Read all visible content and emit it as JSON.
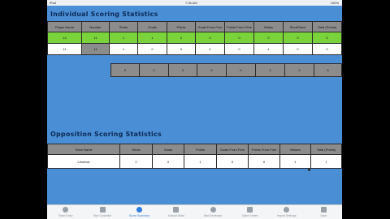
{
  "status": {
    "left": "iPad",
    "time": "7:36 AM",
    "right": "100%"
  },
  "individual": {
    "title": "Individual Scoring Statistics",
    "headers": [
      "Player Name",
      "Number",
      "Shots",
      "Goals",
      "Points",
      "Goals From Free",
      "Points From Free",
      "Wides",
      "Short/Save",
      "Total (Points)"
    ],
    "rows": [
      [
        "14",
        "11",
        "1",
        "1",
        "2",
        "0",
        "0",
        "0",
        "0",
        "5"
      ],
      [
        "11",
        "11",
        "1",
        "0",
        "0",
        "0",
        "0",
        "1",
        "0",
        "0"
      ]
    ],
    "totals": [
      "2",
      "1",
      "2",
      "0",
      "0",
      "1",
      "0",
      "5"
    ]
  },
  "opposition": {
    "title": "Opposition Scoring Statistics",
    "headers": [
      "Team Name",
      "Shots",
      "Goals",
      "Points",
      "Goals From Free",
      "Points From Free",
      "Misses",
      "Total (Points)"
    ],
    "rows": [
      [
        "Limerick",
        "2",
        "0",
        "1",
        "0",
        "0",
        "1",
        "1"
      ]
    ]
  },
  "tabs": [
    {
      "label": "Team Entry",
      "icon": "team-icon"
    },
    {
      "label": "Stat Controller",
      "icon": "controller-icon"
    },
    {
      "label": "Score Summary",
      "icon": "score-icon"
    },
    {
      "label": "Kickout Stats",
      "icon": "kickout-icon"
    },
    {
      "label": "Stat Generator",
      "icon": "generator-icon"
    },
    {
      "label": "Game Notes",
      "icon": "notes-icon"
    },
    {
      "label": "Import Settings",
      "icon": "settings-icon"
    },
    {
      "label": "Save",
      "icon": "save-icon"
    }
  ],
  "active_tab": 2
}
